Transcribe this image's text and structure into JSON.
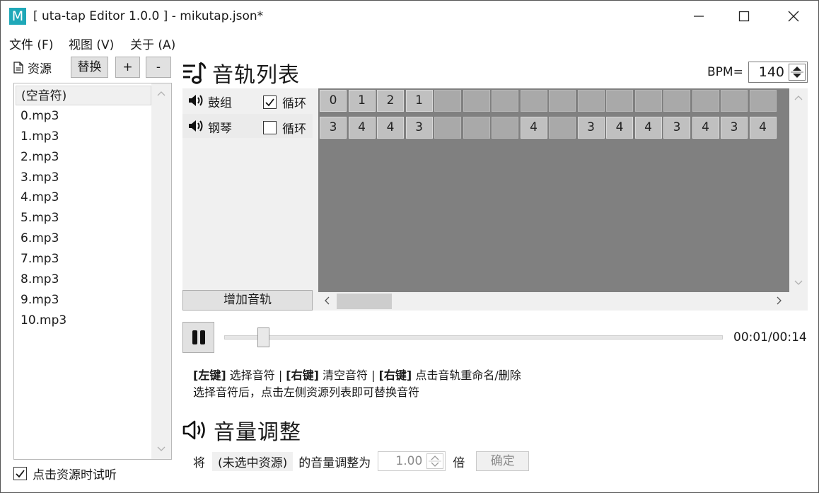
{
  "window": {
    "icon_letter": "M",
    "title": "[ uta-tap Editor 1.0.0 ] - mikutap.json*",
    "min_icon": "minimize-icon",
    "max_icon": "maximize-icon",
    "close_icon": "close-icon"
  },
  "menu": {
    "items": [
      "文件 (F)",
      "视图 (V)",
      "关于 (A)"
    ]
  },
  "resources": {
    "label": "资源",
    "replace_label": "替换",
    "add_label": "+",
    "remove_label": "-",
    "items": [
      "(空音符)",
      "0.mp3",
      "1.mp3",
      "2.mp3",
      "3.mp3",
      "4.mp3",
      "5.mp3",
      "6.mp3",
      "7.mp3",
      "8.mp3",
      "9.mp3",
      "10.mp3"
    ],
    "selected_index": 0,
    "audition_label": "点击资源时试听",
    "audition_checked": true
  },
  "tracks": {
    "title": "音轨列表",
    "bpm_label": "BPM=",
    "bpm_value": "140",
    "add_track_label": "增加音轨",
    "loop_label": "循环",
    "rows": [
      {
        "name": "鼓组",
        "loop": true,
        "cells": [
          "0",
          "1",
          "2",
          "1",
          "",
          "",
          "",
          "",
          "",
          "",
          "",
          "",
          "",
          "",
          "",
          ""
        ]
      },
      {
        "name": "钢琴",
        "loop": false,
        "cells": [
          "3",
          "4",
          "4",
          "3",
          "",
          "",
          "",
          "4",
          "",
          "3",
          "4",
          "4",
          "3",
          "4",
          "3",
          "4"
        ]
      }
    ]
  },
  "playback": {
    "time": "00:01/00:14",
    "progress_fraction": 0.07
  },
  "hints": {
    "line1": [
      {
        "bold": true,
        "text": "[左键]"
      },
      {
        "bold": false,
        "text": " 选择音符 | "
      },
      {
        "bold": true,
        "text": "[右键]"
      },
      {
        "bold": false,
        "text": " 清空音符 | "
      },
      {
        "bold": true,
        "text": "[右键]"
      },
      {
        "bold": false,
        "text": " 点击音轨重命名/删除"
      }
    ],
    "line2": "选择音符后，点击左侧资源列表即可替换音符"
  },
  "volume": {
    "title": "音量调整",
    "prefix": "将",
    "resource": "(未选中资源)",
    "middle": "的音量调整为",
    "value": "1.00",
    "unit": "倍",
    "ok_label": "确定"
  }
}
